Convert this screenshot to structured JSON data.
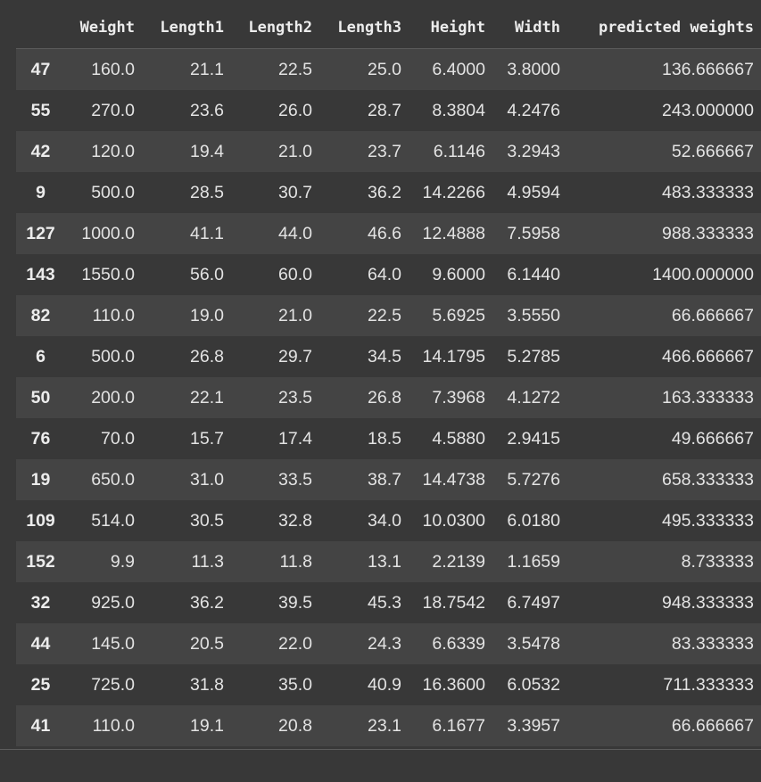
{
  "table": {
    "columns": [
      "Weight",
      "Length1",
      "Length2",
      "Length3",
      "Height",
      "Width",
      "predicted weights"
    ],
    "rows": [
      {
        "index": "47",
        "values": [
          "160.0",
          "21.1",
          "22.5",
          "25.0",
          "6.4000",
          "3.8000",
          "136.666667"
        ]
      },
      {
        "index": "55",
        "values": [
          "270.0",
          "23.6",
          "26.0",
          "28.7",
          "8.3804",
          "4.2476",
          "243.000000"
        ]
      },
      {
        "index": "42",
        "values": [
          "120.0",
          "19.4",
          "21.0",
          "23.7",
          "6.1146",
          "3.2943",
          "52.666667"
        ]
      },
      {
        "index": "9",
        "values": [
          "500.0",
          "28.5",
          "30.7",
          "36.2",
          "14.2266",
          "4.9594",
          "483.333333"
        ]
      },
      {
        "index": "127",
        "values": [
          "1000.0",
          "41.1",
          "44.0",
          "46.6",
          "12.4888",
          "7.5958",
          "988.333333"
        ]
      },
      {
        "index": "143",
        "values": [
          "1550.0",
          "56.0",
          "60.0",
          "64.0",
          "9.6000",
          "6.1440",
          "1400.000000"
        ]
      },
      {
        "index": "82",
        "values": [
          "110.0",
          "19.0",
          "21.0",
          "22.5",
          "5.6925",
          "3.5550",
          "66.666667"
        ]
      },
      {
        "index": "6",
        "values": [
          "500.0",
          "26.8",
          "29.7",
          "34.5",
          "14.1795",
          "5.2785",
          "466.666667"
        ]
      },
      {
        "index": "50",
        "values": [
          "200.0",
          "22.1",
          "23.5",
          "26.8",
          "7.3968",
          "4.1272",
          "163.333333"
        ]
      },
      {
        "index": "76",
        "values": [
          "70.0",
          "15.7",
          "17.4",
          "18.5",
          "4.5880",
          "2.9415",
          "49.666667"
        ]
      },
      {
        "index": "19",
        "values": [
          "650.0",
          "31.0",
          "33.5",
          "38.7",
          "14.4738",
          "5.7276",
          "658.333333"
        ]
      },
      {
        "index": "109",
        "values": [
          "514.0",
          "30.5",
          "32.8",
          "34.0",
          "10.0300",
          "6.0180",
          "495.333333"
        ]
      },
      {
        "index": "152",
        "values": [
          "9.9",
          "11.3",
          "11.8",
          "13.1",
          "2.2139",
          "1.1659",
          "8.733333"
        ]
      },
      {
        "index": "32",
        "values": [
          "925.0",
          "36.2",
          "39.5",
          "45.3",
          "18.7542",
          "6.7497",
          "948.333333"
        ]
      },
      {
        "index": "44",
        "values": [
          "145.0",
          "20.5",
          "22.0",
          "24.3",
          "6.6339",
          "3.5478",
          "83.333333"
        ]
      },
      {
        "index": "25",
        "values": [
          "725.0",
          "31.8",
          "35.0",
          "40.9",
          "16.3600",
          "6.0532",
          "711.333333"
        ]
      },
      {
        "index": "41",
        "values": [
          "110.0",
          "19.1",
          "20.8",
          "23.1",
          "6.1677",
          "3.3957",
          "66.666667"
        ]
      }
    ]
  },
  "colors": {
    "background": "#383838",
    "row_stripe": "#444444",
    "text": "#e3e3e3"
  }
}
